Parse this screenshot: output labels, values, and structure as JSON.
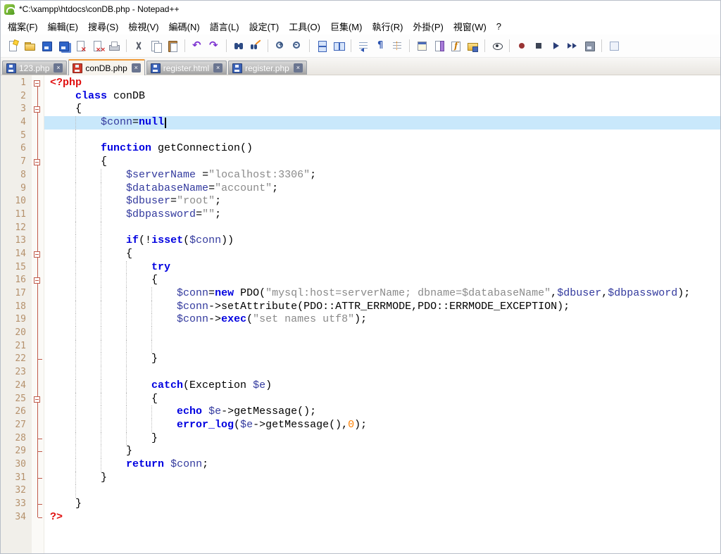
{
  "window": {
    "title": "*C:\\xampp\\htdocs\\conDB.php - Notepad++"
  },
  "menu_bar": {
    "items": [
      {
        "id": "file",
        "label": "檔案(F)"
      },
      {
        "id": "edit",
        "label": "編輯(E)"
      },
      {
        "id": "search",
        "label": "搜尋(S)"
      },
      {
        "id": "view",
        "label": "檢視(V)"
      },
      {
        "id": "encoding",
        "label": "編碼(N)"
      },
      {
        "id": "language",
        "label": "語言(L)"
      },
      {
        "id": "settings",
        "label": "設定(T)"
      },
      {
        "id": "tools",
        "label": "工具(O)"
      },
      {
        "id": "macro",
        "label": "巨集(M)"
      },
      {
        "id": "run",
        "label": "執行(R)"
      },
      {
        "id": "plugins",
        "label": "外掛(P)"
      },
      {
        "id": "window",
        "label": "視窗(W)"
      },
      {
        "id": "help",
        "label": "?"
      }
    ]
  },
  "toolbar": {
    "buttons": [
      "new-file",
      "open-file",
      "save",
      "save-all",
      "close",
      "close-all",
      "print",
      "|",
      "cut",
      "copy",
      "paste",
      "|",
      "undo",
      "redo",
      "|",
      "find",
      "replace",
      "|",
      "zoom-in",
      "zoom-out",
      "|",
      "sync-vertical",
      "sync-horizontal",
      "|",
      "word-wrap",
      "show-all-characters",
      "indent-guide",
      "|",
      "user-defined-language",
      "document-map",
      "function-list",
      "folder-as-workspace",
      "|",
      "monitoring",
      "|",
      "record-macro",
      "stop-macro",
      "playback-macro",
      "run-macro-multiple",
      "save-macro",
      "|",
      "doc-switcher"
    ]
  },
  "tab_close_glyph": "×",
  "tabs": [
    {
      "label": "123.php",
      "active": false,
      "modified": false
    },
    {
      "label": "conDB.php",
      "active": true,
      "modified": true
    },
    {
      "label": "register.html",
      "active": false,
      "modified": false
    },
    {
      "label": "register.php",
      "active": false,
      "modified": false
    }
  ],
  "colors": {
    "accent_tab_top": "#ef9b3a",
    "modified_doc": "#cf3a2a",
    "saved_doc": "#3a62b8",
    "keyword": "#0000e0",
    "variable": "#333a9e",
    "string": "#8a8a8a",
    "number": "#ff8000",
    "php_tag": "#e01010",
    "plain": "#000000",
    "current_line_bg": "#c9e8fb",
    "line_number": "#b5916c",
    "fold_mark": "#c05a4a"
  },
  "editor": {
    "language_hint": "PHP",
    "current_line": 4,
    "lines": [
      {
        "num": 1,
        "indent": 0,
        "fold": "boxtop",
        "tokens": [
          [
            "<?php",
            "t"
          ]
        ]
      },
      {
        "num": 2,
        "indent": 4,
        "fold": "vline",
        "tokens": [
          [
            "class",
            "k"
          ],
          [
            " conDB",
            "p"
          ]
        ]
      },
      {
        "num": 3,
        "indent": 4,
        "fold": "box",
        "tokens": [
          [
            "{",
            "p"
          ]
        ]
      },
      {
        "num": 4,
        "indent": 8,
        "fold": "vline",
        "caret": true,
        "tokens": [
          [
            "$conn",
            "v"
          ],
          [
            "=",
            "p"
          ],
          [
            "null",
            "k"
          ]
        ]
      },
      {
        "num": 5,
        "indent": 8,
        "fold": "vline",
        "tokens": []
      },
      {
        "num": 6,
        "indent": 8,
        "fold": "vline",
        "tokens": [
          [
            "function",
            "k"
          ],
          [
            " getConnection()",
            "p"
          ]
        ]
      },
      {
        "num": 7,
        "indent": 8,
        "fold": "box",
        "tokens": [
          [
            "{",
            "p"
          ]
        ]
      },
      {
        "num": 8,
        "indent": 12,
        "fold": "vline",
        "tokens": [
          [
            "$serverName",
            "v"
          ],
          [
            " =",
            "p"
          ],
          [
            "\"localhost:3306\"",
            "s"
          ],
          [
            ";",
            "p"
          ]
        ]
      },
      {
        "num": 9,
        "indent": 12,
        "fold": "vline",
        "tokens": [
          [
            "$databaseName",
            "v"
          ],
          [
            "=",
            "p"
          ],
          [
            "\"account\"",
            "s"
          ],
          [
            ";",
            "p"
          ]
        ]
      },
      {
        "num": 10,
        "indent": 12,
        "fold": "vline",
        "tokens": [
          [
            "$dbuser",
            "v"
          ],
          [
            "=",
            "p"
          ],
          [
            "\"root\"",
            "s"
          ],
          [
            ";",
            "p"
          ]
        ]
      },
      {
        "num": 11,
        "indent": 12,
        "fold": "vline",
        "tokens": [
          [
            "$dbpassword",
            "v"
          ],
          [
            "=",
            "p"
          ],
          [
            "\"\"",
            "s"
          ],
          [
            ";",
            "p"
          ]
        ]
      },
      {
        "num": 12,
        "indent": 12,
        "fold": "vline",
        "tokens": []
      },
      {
        "num": 13,
        "indent": 12,
        "fold": "vline",
        "tokens": [
          [
            "if",
            "k"
          ],
          [
            "(!",
            "p"
          ],
          [
            "isset",
            "k"
          ],
          [
            "(",
            "p"
          ],
          [
            "$conn",
            "v"
          ],
          [
            "))",
            "p"
          ]
        ]
      },
      {
        "num": 14,
        "indent": 12,
        "fold": "box",
        "tokens": [
          [
            "{",
            "p"
          ]
        ]
      },
      {
        "num": 15,
        "indent": 16,
        "fold": "vline",
        "tokens": [
          [
            "try",
            "k"
          ]
        ]
      },
      {
        "num": 16,
        "indent": 16,
        "fold": "box",
        "tokens": [
          [
            "{",
            "p"
          ]
        ]
      },
      {
        "num": 17,
        "indent": 20,
        "fold": "vline",
        "tokens": [
          [
            "$conn",
            "v"
          ],
          [
            "=",
            "p"
          ],
          [
            "new",
            "k"
          ],
          [
            " PDO(",
            "p"
          ],
          [
            "\"mysql:host=serverName; dbname=$databaseName\"",
            "s"
          ],
          [
            ",",
            "p"
          ],
          [
            "$dbuser",
            "v"
          ],
          [
            ",",
            "p"
          ],
          [
            "$dbpassword",
            "v"
          ],
          [
            ");",
            "p"
          ]
        ]
      },
      {
        "num": 18,
        "indent": 20,
        "fold": "vline",
        "tokens": [
          [
            "$conn",
            "v"
          ],
          [
            "->setAttribute(PDO::ATTR_ERRMODE,PDO::ERRMODE_EXCEPTION);",
            "p"
          ]
        ]
      },
      {
        "num": 19,
        "indent": 20,
        "fold": "vline",
        "tokens": [
          [
            "$conn",
            "v"
          ],
          [
            "->",
            "p"
          ],
          [
            "exec",
            "k"
          ],
          [
            "(",
            "p"
          ],
          [
            "\"set names utf8\"",
            "s"
          ],
          [
            ");",
            "p"
          ]
        ]
      },
      {
        "num": 20,
        "indent": 20,
        "fold": "vline",
        "tokens": []
      },
      {
        "num": 21,
        "indent": 20,
        "fold": "vline",
        "tokens": []
      },
      {
        "num": 22,
        "indent": 16,
        "fold": "tee",
        "tokens": [
          [
            "}",
            "p"
          ]
        ]
      },
      {
        "num": 23,
        "indent": 16,
        "fold": "vline",
        "tokens": []
      },
      {
        "num": 24,
        "indent": 16,
        "fold": "vline",
        "tokens": [
          [
            "catch",
            "k"
          ],
          [
            "(Exception ",
            "p"
          ],
          [
            "$e",
            "v"
          ],
          [
            ")",
            "p"
          ]
        ]
      },
      {
        "num": 25,
        "indent": 16,
        "fold": "box",
        "tokens": [
          [
            "{",
            "p"
          ]
        ]
      },
      {
        "num": 26,
        "indent": 20,
        "fold": "vline",
        "tokens": [
          [
            "echo",
            "k"
          ],
          [
            " ",
            "p"
          ],
          [
            "$e",
            "v"
          ],
          [
            "->getMessage();",
            "p"
          ]
        ]
      },
      {
        "num": 27,
        "indent": 20,
        "fold": "vline",
        "tokens": [
          [
            "error_log",
            "k"
          ],
          [
            "(",
            "p"
          ],
          [
            "$e",
            "v"
          ],
          [
            "->getMessage(),",
            "p"
          ],
          [
            "0",
            "n"
          ],
          [
            ");",
            "p"
          ]
        ]
      },
      {
        "num": 28,
        "indent": 16,
        "fold": "tee",
        "tokens": [
          [
            "}",
            "p"
          ]
        ]
      },
      {
        "num": 29,
        "indent": 12,
        "fold": "tee",
        "tokens": [
          [
            "}",
            "p"
          ]
        ]
      },
      {
        "num": 30,
        "indent": 12,
        "fold": "vline",
        "tokens": [
          [
            "return",
            "k"
          ],
          [
            " ",
            "p"
          ],
          [
            "$conn",
            "v"
          ],
          [
            ";",
            "p"
          ]
        ]
      },
      {
        "num": 31,
        "indent": 8,
        "fold": "tee",
        "tokens": [
          [
            "}",
            "p"
          ]
        ]
      },
      {
        "num": 32,
        "indent": 8,
        "fold": "vline",
        "tokens": []
      },
      {
        "num": 33,
        "indent": 4,
        "fold": "tee",
        "tokens": [
          [
            "}",
            "p"
          ]
        ]
      },
      {
        "num": 34,
        "indent": 0,
        "fold": "corner",
        "tokens": [
          [
            "?>",
            "t"
          ]
        ]
      }
    ]
  }
}
